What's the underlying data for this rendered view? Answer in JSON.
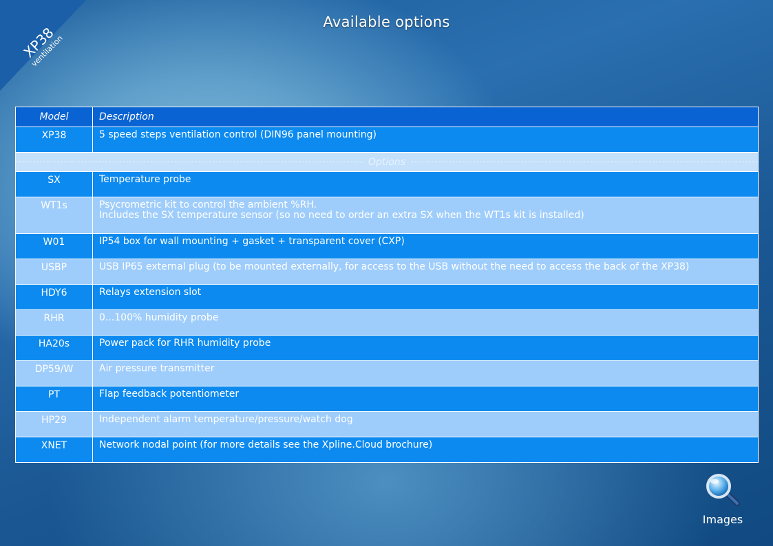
{
  "corner": {
    "brand": "XP38",
    "subtitle": "ventilation"
  },
  "page": {
    "title": "Available options"
  },
  "table": {
    "headers": {
      "model": "Model",
      "description": "Description"
    },
    "separator_label": "Options",
    "main_row": {
      "model": "XP38",
      "description": [
        "5 speed steps ventilation control  (DIN96 panel mounting)"
      ]
    },
    "rows": [
      {
        "model": "SX",
        "description": [
          "Temperature probe"
        ]
      },
      {
        "model": "WT1s",
        "description": [
          "Psycrometric kit to control the ambient %RH.",
          "Includes the SX temperature sensor (so no need to order an extra SX when the WT1s kit is installed)"
        ]
      },
      {
        "model": "W01",
        "description": [
          "IP54 box for wall mounting + gasket + transparent cover (CXP)"
        ]
      },
      {
        "model": "USBP",
        "description": [
          "USB IP65 external plug  (to be mounted externally, for access to the USB without the need to access the back of the XP38)"
        ]
      },
      {
        "model": "HDY6",
        "description": [
          "Relays extension slot"
        ]
      },
      {
        "model": "RHR",
        "description": [
          "0...100% humidity probe"
        ]
      },
      {
        "model": "HA20s",
        "description": [
          "Power pack for RHR humidity probe"
        ]
      },
      {
        "model": "DP59/W",
        "description": [
          "Air pressure transmitter"
        ]
      },
      {
        "model": "PT",
        "description": [
          "Flap feedback potentiometer"
        ]
      },
      {
        "model": "HP29",
        "description": [
          "Independent alarm temperature/pressure/watch dog"
        ]
      },
      {
        "model": "XNET",
        "description": [
          "Network nodal point (for more details see the Xpline.Cloud brochure)"
        ]
      }
    ]
  },
  "images_button": {
    "label": "Images",
    "icon": "magnifier-icon"
  }
}
